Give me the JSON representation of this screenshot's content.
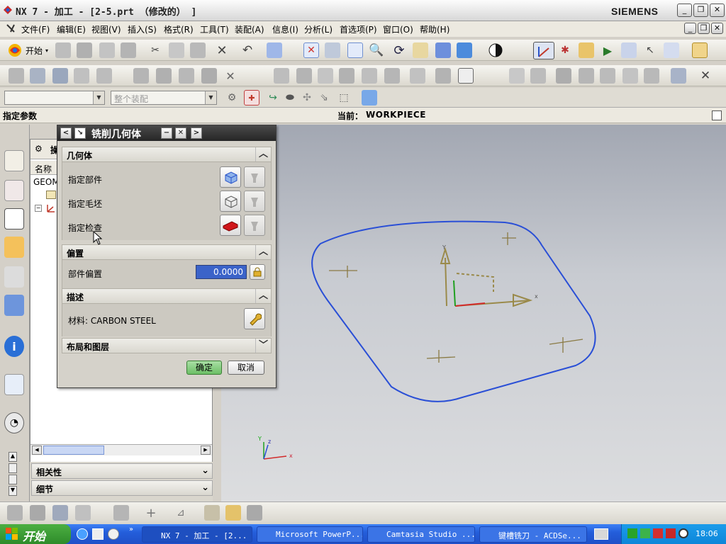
{
  "window": {
    "title": "NX 7 - 加工 - [2-5.prt （修改的） ]",
    "brand": "SIEMENS"
  },
  "menu": [
    "文件(F)",
    "编辑(E)",
    "视图(V)",
    "插入(S)",
    "格式(R)",
    "工具(T)",
    "装配(A)",
    "信息(I)",
    "分析(L)",
    "首选项(P)",
    "窗口(O)",
    "帮助(H)"
  ],
  "toolbar": {
    "start_label": "开始",
    "start_suffix": "▾"
  },
  "filter": {
    "type_value": "",
    "scope_value": "整个装配"
  },
  "cueline": {
    "prompt": "指定参数",
    "current_label": "当前：",
    "current_value": "WORKPIECE"
  },
  "nav": {
    "header_icon": "gear-icon",
    "header_label": "操",
    "column_name": "名称",
    "root_item": "GEOM"
  },
  "nav_sections": {
    "related": "相关性",
    "details": "细节"
  },
  "dialog": {
    "title": "铣削几何体",
    "geometry": {
      "header": "几何体",
      "part": "指定部件",
      "blank": "指定毛坯",
      "check": "指定检查"
    },
    "offset": {
      "header": "偏置",
      "part_offset_label": "部件偏置",
      "part_offset_value": "0.0000"
    },
    "description": {
      "header": "描述",
      "material_label": "材料: ",
      "material_value": "CARBON STEEL"
    },
    "layout": {
      "header": "布局和图层"
    },
    "ok": "确定",
    "cancel": "取消"
  },
  "view_triad": {
    "x": "x",
    "y": "y",
    "z": "z"
  },
  "triad_small": {
    "x": "x",
    "y": "Y",
    "z": "z"
  },
  "taskbar": {
    "start": "开始",
    "tasks": [
      "NX 7 - 加工 - [2...",
      "Microsoft PowerP...",
      "Camtasia Studio ...",
      "键槽铣刀 - ACDSe..."
    ],
    "clock": "18:06"
  },
  "colors": {
    "accent": "#1f50c8",
    "curve": "#2a4fd6",
    "ok_button": "#7fc87a"
  }
}
